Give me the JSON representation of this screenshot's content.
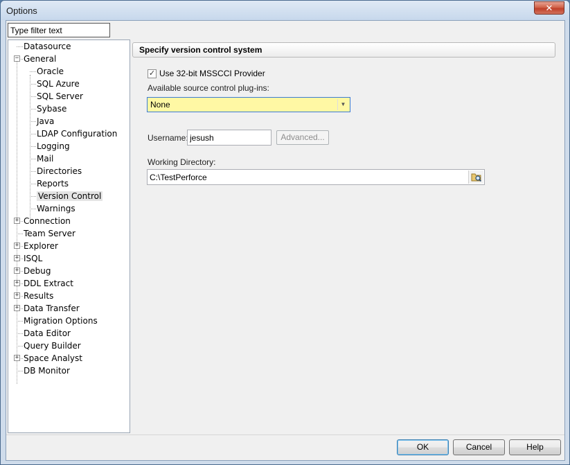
{
  "window": {
    "title": "Options",
    "close_glyph": "✕"
  },
  "filter": {
    "placeholder": "Type filter text"
  },
  "tree": {
    "items": [
      {
        "label": "Datasource",
        "level": 0,
        "expander": ""
      },
      {
        "label": "General",
        "level": 0,
        "expander": "−"
      },
      {
        "label": "Oracle",
        "level": 1,
        "expander": ""
      },
      {
        "label": "SQL Azure",
        "level": 1,
        "expander": ""
      },
      {
        "label": "SQL Server",
        "level": 1,
        "expander": ""
      },
      {
        "label": "Sybase",
        "level": 1,
        "expander": ""
      },
      {
        "label": "Java",
        "level": 1,
        "expander": ""
      },
      {
        "label": "LDAP Configuration",
        "level": 1,
        "expander": ""
      },
      {
        "label": "Logging",
        "level": 1,
        "expander": ""
      },
      {
        "label": "Mail",
        "level": 1,
        "expander": ""
      },
      {
        "label": "Directories",
        "level": 1,
        "expander": ""
      },
      {
        "label": "Reports",
        "level": 1,
        "expander": ""
      },
      {
        "label": "Version Control",
        "level": 1,
        "expander": "",
        "selected": true
      },
      {
        "label": "Warnings",
        "level": 1,
        "expander": ""
      },
      {
        "label": "Connection",
        "level": 0,
        "expander": "+"
      },
      {
        "label": "Team Server",
        "level": 0,
        "expander": ""
      },
      {
        "label": "Explorer",
        "level": 0,
        "expander": "+"
      },
      {
        "label": "ISQL",
        "level": 0,
        "expander": "+"
      },
      {
        "label": "Debug",
        "level": 0,
        "expander": "+"
      },
      {
        "label": "DDL Extract",
        "level": 0,
        "expander": "+"
      },
      {
        "label": "Results",
        "level": 0,
        "expander": "+"
      },
      {
        "label": "Data Transfer",
        "level": 0,
        "expander": "+"
      },
      {
        "label": "Migration Options",
        "level": 0,
        "expander": ""
      },
      {
        "label": "Data Editor",
        "level": 0,
        "expander": ""
      },
      {
        "label": "Query Builder",
        "level": 0,
        "expander": ""
      },
      {
        "label": "Space Analyst",
        "level": 0,
        "expander": "+"
      },
      {
        "label": "DB Monitor",
        "level": 0,
        "expander": ""
      }
    ]
  },
  "panel": {
    "header": "Specify version control system",
    "use32bit": {
      "label": "Use 32-bit MSSCCI Provider",
      "checked": true,
      "glyph": "✓"
    },
    "plugins_label": "Available source control plug-ins:",
    "plugin_selected": "None",
    "plugin_arrow": "▼",
    "username_label": "Username:",
    "username_value": "jesush",
    "advanced_label": "Advanced...",
    "workdir_label": "Working Directory:",
    "workdir_value": "C:\\TestPerforce",
    "browse_icon": "folder-search-icon"
  },
  "buttons": {
    "ok": "OK",
    "cancel": "Cancel",
    "help": "Help"
  },
  "colors": {
    "dropdown_bg": "#fff8a4",
    "dropdown_border": "#3a7bd4",
    "close_red": "#c0402a"
  }
}
